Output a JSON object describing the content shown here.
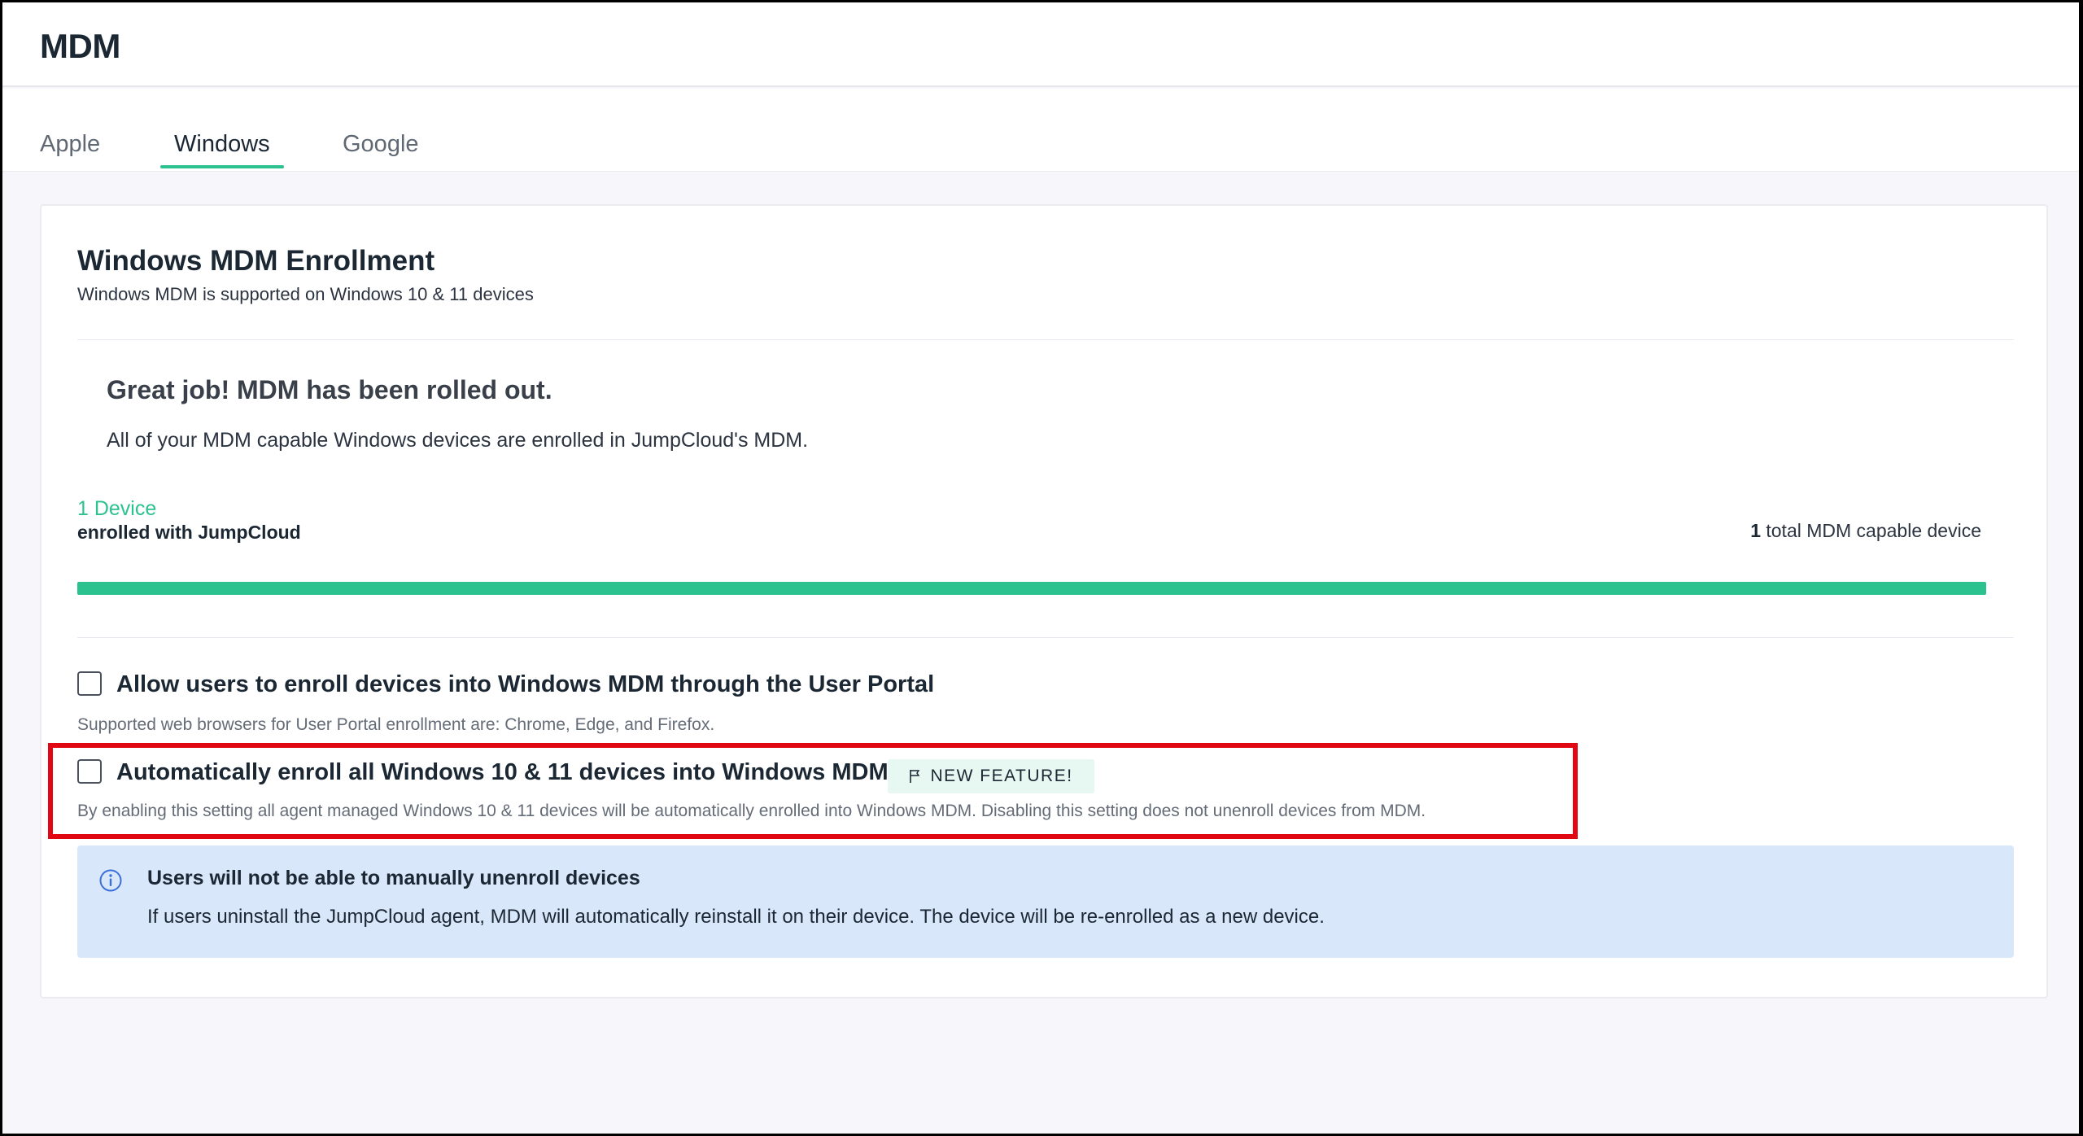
{
  "header": {
    "title": "MDM"
  },
  "tabs": [
    {
      "label": "Apple",
      "active": false
    },
    {
      "label": "Windows",
      "active": true
    },
    {
      "label": "Google",
      "active": false
    }
  ],
  "enrollment": {
    "title": "Windows MDM Enrollment",
    "subtitle": "Windows MDM is supported on Windows 10 & 11 devices",
    "rollout_title": "Great job! MDM has been rolled out.",
    "rollout_desc": "All of your MDM capable Windows devices are enrolled in JumpCloud's MDM.",
    "device_count_label": "1 Device",
    "enrolled_label": "enrolled with JumpCloud",
    "total_capable_count": "1",
    "total_capable_label": "total MDM capable device",
    "progress_fraction": 1.0
  },
  "options": {
    "user_portal": {
      "label": "Allow users to enroll devices into Windows MDM through the User Portal",
      "help": "Supported web browsers for User Portal enrollment are: Chrome, Edge, and Firefox.",
      "checked": false
    },
    "auto_enroll": {
      "label": "Automatically enroll all Windows 10 & 11 devices into Windows MDM",
      "badge": "NEW FEATURE!",
      "help": "By enabling this setting all agent managed Windows 10 & 11 devices will be automatically enrolled into Windows MDM. Disabling this setting does not unenroll devices from MDM.",
      "checked": false
    }
  },
  "info": {
    "title": "Users will not be able to manually unenroll devices",
    "text": "If users uninstall the JumpCloud agent, MDM will automatically reinstall it on their device. The device will be re-enrolled as a new device."
  },
  "colors": {
    "accent_green": "#2bc28f",
    "highlight_red": "#e00712",
    "info_bg": "#d9e7fb",
    "badge_bg": "#e6f8f1"
  },
  "icons": {
    "info": "info-icon",
    "badge": "flag-icon"
  }
}
